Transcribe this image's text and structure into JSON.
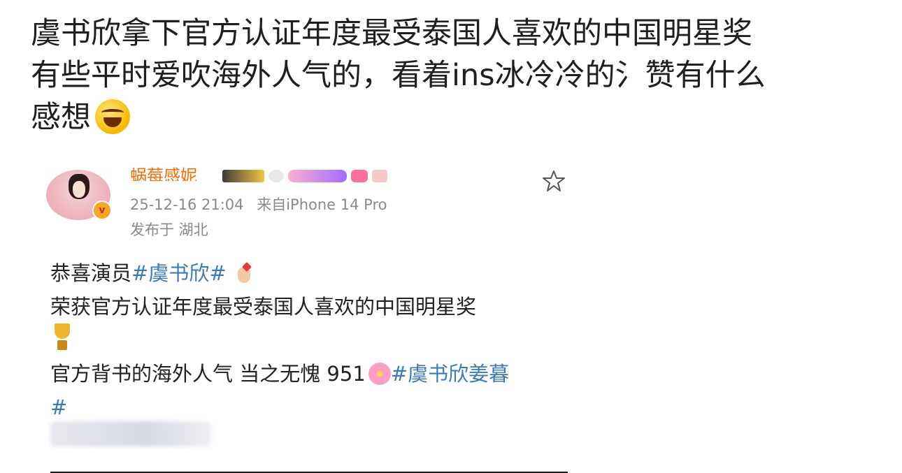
{
  "post": {
    "line1": "虞书欣拿下官方认证年度最受泰国人喜欢的中国明星奖",
    "line2": "有些平时爱吹海外人气的，看着ins冰冷冷的氵赞有什么",
    "line3": "感想",
    "emoji": "laughing-tears"
  },
  "embedded": {
    "username": "蜗莓感妮",
    "timestamp": "25-12-16 21:04",
    "source": "来自iPhone 14 Pro",
    "location": "发布于 湖北",
    "body": {
      "row1_text": "恭喜演员",
      "row1_tag": "#虞书欣#",
      "row2": "荣获官方认证年度最受泰国人喜欢的中国明星奖",
      "row4_text": "官方背书的海外人气 当之无愧 951",
      "row4_tag": "#虞书欣姜暮",
      "row5_tag": "#"
    },
    "accent_color": "#3d7bb8",
    "username_color": "#ff6a00"
  }
}
